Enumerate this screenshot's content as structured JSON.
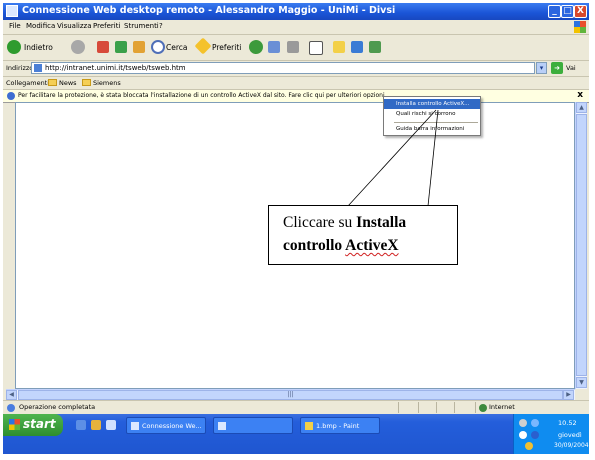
{
  "window": {
    "title": "Connessione Web desktop remoto - Alessandro Maggio -  UniMi - Divsi",
    "controls": [
      "_",
      "□",
      "X"
    ]
  },
  "menu": [
    "File",
    "Modifica",
    "Visualizza",
    "Preferiti",
    "Strumenti",
    "?"
  ],
  "toolbar": {
    "back": "Indietro",
    "search": "Cerca",
    "favorites": "Preferiti"
  },
  "address": {
    "label": "Indirizzo",
    "url": "http://intranet.unimi.it/tsweb/tsweb.htm",
    "go": "Vai"
  },
  "links": {
    "label": "Collegamenti",
    "items": [
      "News",
      "Siemens"
    ]
  },
  "infobar": {
    "message": "Per facilitare la protezione, è stata bloccata l'installazione di un controllo ActiveX dal sito. Fare clic qui per ulteriori opzioni...",
    "close": "x"
  },
  "context_menu": {
    "items": [
      "Installa controllo ActiveX...",
      "Quali rischi si corrono",
      "Guida barra informazioni"
    ]
  },
  "annotation": {
    "line1_prefix": "Cliccare su",
    "line1_bold": "Installa",
    "line2_bold": "controllo",
    "line2_underlined": "ActiveX"
  },
  "status": {
    "text": "Operazione completata",
    "zone": "Internet"
  },
  "taskbar": {
    "start": "start",
    "tasks": [
      "Connessione We...",
      "",
      "1.bmp - Paint"
    ],
    "clock": "10.52",
    "day": "giovedì",
    "date": "30/09/2004"
  }
}
